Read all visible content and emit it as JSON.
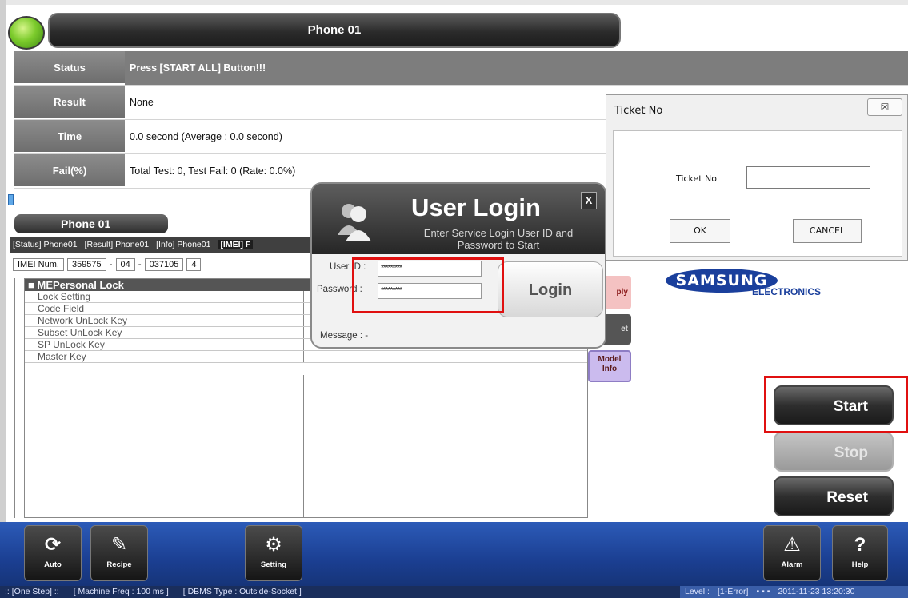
{
  "title": "Phone 01",
  "info_rows": [
    {
      "label": "Status",
      "value": "Press [START ALL] Button!!!"
    },
    {
      "label": "Result",
      "value": "None"
    },
    {
      "label": "Time",
      "value": "0.0 second (Average : 0.0 second)"
    },
    {
      "label": "Fail(%)",
      "value": "Total Test: 0, Test Fail: 0 (Rate: 0.0%)"
    }
  ],
  "phone_tab": "Phone 01",
  "subtabs": [
    "[Status] Phone01",
    "[Result] Phone01",
    "[Info] Phone01",
    "[IMEI] F"
  ],
  "imei": {
    "label": "IMEI Num.",
    "part1": "359575",
    "part2": "04",
    "part3": "037105",
    "part4": "4",
    "sep": "-"
  },
  "grid": {
    "header": "MEPersonal Lock",
    "header_mark": "■",
    "rows": [
      "Lock Setting",
      "Code Field",
      "Network UnLock Key",
      "Subset UnLock Key",
      "SP UnLock Key",
      "Master Key"
    ]
  },
  "side_buttons": {
    "apply": "ply",
    "set": "et",
    "model_line1": "Model",
    "model_line2": "Info"
  },
  "brand": {
    "name": "SAMSUNG",
    "sub": "ELECTRONICS"
  },
  "controls": {
    "start": "Start",
    "stop": "Stop",
    "reset": "Reset"
  },
  "toolbar": {
    "auto": "Auto",
    "recipe": "Recipe",
    "setting": "Setting",
    "alarm": "Alarm",
    "help": "Help"
  },
  "statusbar": {
    "one_step": ":: [One Step] ::",
    "machine_freq": "[ Machine Freq : 100 ms ]",
    "dbms_type": "[ DBMS Type : Outside-Socket ]",
    "level": "Level :",
    "error": "[1-Error]",
    "datetime": "2011-11-23 13:20:30"
  },
  "ticket_dialog": {
    "title": "Ticket No",
    "close": "☒",
    "label": "Ticket No",
    "input_value": "",
    "ok": "OK",
    "cancel": "CANCEL"
  },
  "login_dialog": {
    "title": "User Login",
    "subtitle": "Enter Service Login User ID and Password to Start",
    "close": "X",
    "user_label": "User ID :",
    "user_value": "*********",
    "password_label": "Password :",
    "password_value": "*********",
    "login_button": "Login",
    "message_label": "Message : -"
  },
  "colors": {
    "title_bar": "#2b2b2b",
    "status_row": "#7d7d7d",
    "toolbar": "#1b3f92",
    "highlight": "#e01010",
    "brand": "#1a3f9c"
  }
}
